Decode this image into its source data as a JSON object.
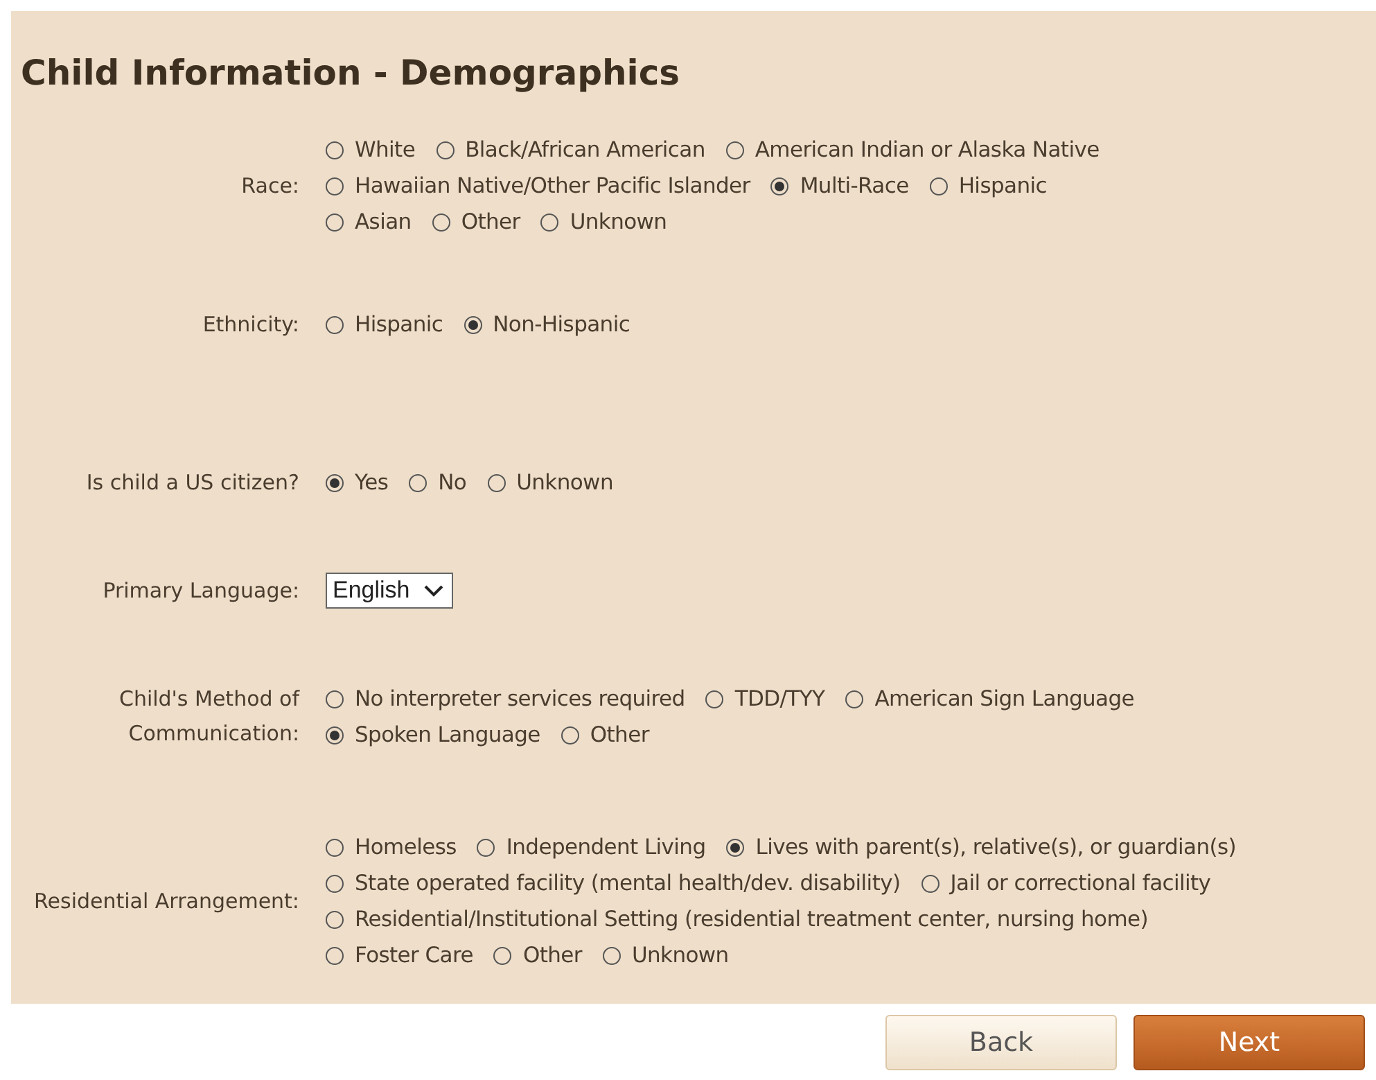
{
  "title": "Child Information - Demographics",
  "fields": [
    {
      "kind": "radio",
      "label": "Race:",
      "lines": [
        [
          {
            "label": "White",
            "selected": false
          },
          {
            "label": "Black/African American",
            "selected": false
          },
          {
            "label": "American Indian or Alaska Native",
            "selected": false
          }
        ],
        [
          {
            "label": "Hawaiian Native/Other Pacific Islander",
            "selected": false
          },
          {
            "label": "Multi-Race",
            "selected": true
          },
          {
            "label": "Hispanic",
            "selected": false
          }
        ],
        [
          {
            "label": "Asian",
            "selected": false
          },
          {
            "label": "Other",
            "selected": false
          },
          {
            "label": "Unknown",
            "selected": false
          }
        ]
      ]
    },
    {
      "kind": "radio",
      "label": "Ethnicity:",
      "lines": [
        [
          {
            "label": "Hispanic",
            "selected": false
          },
          {
            "label": "Non-Hispanic",
            "selected": true
          }
        ]
      ]
    },
    {
      "kind": "radio",
      "label": "Is child a US citizen?",
      "lines": [
        [
          {
            "label": "Yes",
            "selected": true
          },
          {
            "label": "No",
            "selected": false
          },
          {
            "label": "Unknown",
            "selected": false
          }
        ]
      ]
    },
    {
      "kind": "select",
      "label": "Primary Language:",
      "value": "English"
    },
    {
      "kind": "radio",
      "label": "Child's Method of Communication:",
      "lines": [
        [
          {
            "label": "No interpreter services required",
            "selected": false
          },
          {
            "label": "TDD/TYY",
            "selected": false
          },
          {
            "label": "American Sign Language",
            "selected": false
          }
        ],
        [
          {
            "label": "Spoken Language",
            "selected": true
          },
          {
            "label": "Other",
            "selected": false
          }
        ]
      ]
    },
    {
      "kind": "radio",
      "label": "Residential Arrangement:",
      "lines": [
        [
          {
            "label": "Homeless",
            "selected": false
          },
          {
            "label": "Independent Living",
            "selected": false
          },
          {
            "label": "Lives with parent(s), relative(s), or guardian(s)",
            "selected": true
          }
        ],
        [
          {
            "label": "State operated facility (mental health/dev. disability)",
            "selected": false
          },
          {
            "label": "Jail or correctional facility",
            "selected": false
          }
        ],
        [
          {
            "label": "Residential/Institutional Setting (residential treatment center, nursing home)",
            "selected": false
          }
        ],
        [
          {
            "label": "Foster Care",
            "selected": false
          },
          {
            "label": "Other",
            "selected": false
          },
          {
            "label": "Unknown",
            "selected": false
          }
        ]
      ]
    }
  ],
  "buttons": [
    {
      "label": "Back",
      "kind": "secondary"
    },
    {
      "label": "Next",
      "kind": "primary"
    }
  ]
}
